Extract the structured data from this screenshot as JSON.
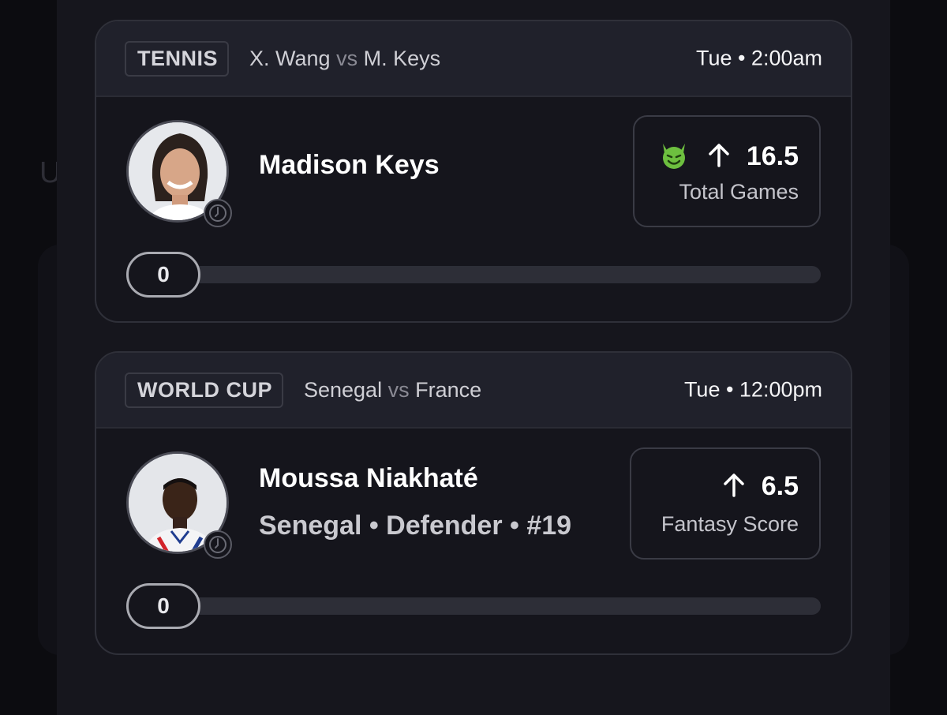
{
  "background": {
    "ghost_letter": "U"
  },
  "cards": [
    {
      "sport_tag": "TENNIS",
      "team_a": "X. Wang",
      "vs": "vs",
      "team_b": "M. Keys",
      "time": "Tue • 2:00am",
      "player_name": "Madison Keys",
      "player_sub": "",
      "direction": "up",
      "line_value": "16.5",
      "line_label": "Total Games",
      "progress_value": "0",
      "badge_icon": "demon-emoji-icon"
    },
    {
      "sport_tag": "WORLD CUP",
      "team_a": "Senegal",
      "vs": "vs",
      "team_b": "France",
      "time": "Tue • 12:00pm",
      "player_name": "Moussa Niakhaté",
      "player_sub": "Senegal • Defender • #19",
      "direction": "up",
      "line_value": "6.5",
      "line_label": "Fantasy Score",
      "progress_value": "0"
    }
  ],
  "colors": {
    "panel": "#16161d",
    "card_header": "#20212b",
    "accent_green": "#6dbf3f"
  }
}
